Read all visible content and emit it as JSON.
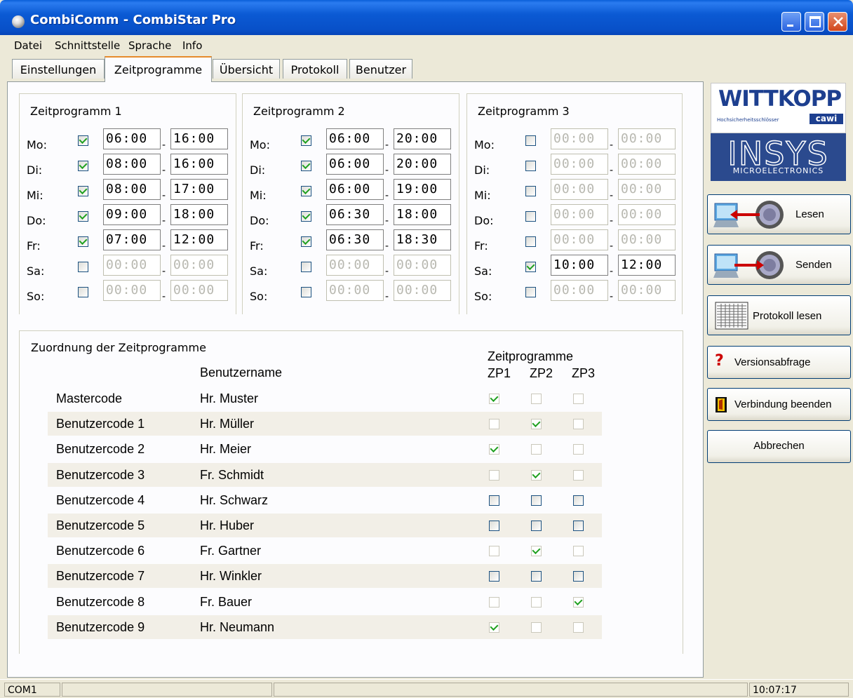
{
  "window": {
    "title": "CombiComm - CombiStar Pro"
  },
  "menu": [
    "Datei",
    "Schnittstelle",
    "Sprache",
    "Info"
  ],
  "tabs": [
    "Einstellungen",
    "Zeitprogramme",
    "Übersicht",
    "Protokoll",
    "Benutzer"
  ],
  "active_tab": "Zeitprogramme",
  "days": [
    "Mo:",
    "Di:",
    "Mi:",
    "Do:",
    "Fr:",
    "Sa:",
    "So:"
  ],
  "zeitprogramme": [
    {
      "title": "Zeitprogramm 1",
      "rows": [
        {
          "checked": true,
          "from": "06:00",
          "to": "16:00"
        },
        {
          "checked": true,
          "from": "08:00",
          "to": "16:00"
        },
        {
          "checked": true,
          "from": "08:00",
          "to": "17:00"
        },
        {
          "checked": true,
          "from": "09:00",
          "to": "18:00"
        },
        {
          "checked": true,
          "from": "07:00",
          "to": "12:00"
        },
        {
          "checked": false,
          "from": "00:00",
          "to": "00:00"
        },
        {
          "checked": false,
          "from": "00:00",
          "to": "00:00"
        }
      ]
    },
    {
      "title": "Zeitprogramm 2",
      "rows": [
        {
          "checked": true,
          "from": "06:00",
          "to": "20:00"
        },
        {
          "checked": true,
          "from": "06:00",
          "to": "20:00"
        },
        {
          "checked": true,
          "from": "06:00",
          "to": "19:00"
        },
        {
          "checked": true,
          "from": "06:30",
          "to": "18:00"
        },
        {
          "checked": true,
          "from": "06:30",
          "to": "18:30"
        },
        {
          "checked": false,
          "from": "00:00",
          "to": "00:00"
        },
        {
          "checked": false,
          "from": "00:00",
          "to": "00:00"
        }
      ]
    },
    {
      "title": "Zeitprogramm 3",
      "rows": [
        {
          "checked": false,
          "from": "00:00",
          "to": "00:00"
        },
        {
          "checked": false,
          "from": "00:00",
          "to": "00:00"
        },
        {
          "checked": false,
          "from": "00:00",
          "to": "00:00"
        },
        {
          "checked": false,
          "from": "00:00",
          "to": "00:00"
        },
        {
          "checked": false,
          "from": "00:00",
          "to": "00:00"
        },
        {
          "checked": true,
          "from": "10:00",
          "to": "12:00"
        },
        {
          "checked": false,
          "from": "00:00",
          "to": "00:00"
        }
      ]
    }
  ],
  "assignment": {
    "title": "Zuordnung der Zeitprogramme",
    "name_header": "Benutzername",
    "zp_header": "Zeitprogramme",
    "zp_cols": [
      "ZP1",
      "ZP2",
      "ZP3"
    ],
    "rows": [
      {
        "code": "Mastercode",
        "name": "Hr. Muster",
        "zp": [
          true,
          false,
          false
        ],
        "enabled": false
      },
      {
        "code": "Benutzercode 1",
        "name": "Hr. Müller",
        "zp": [
          false,
          true,
          false
        ],
        "enabled": false
      },
      {
        "code": "Benutzercode 2",
        "name": "Hr. Meier",
        "zp": [
          true,
          false,
          false
        ],
        "enabled": false
      },
      {
        "code": "Benutzercode 3",
        "name": "Fr. Schmidt",
        "zp": [
          false,
          true,
          false
        ],
        "enabled": false
      },
      {
        "code": "Benutzercode 4",
        "name": "Hr. Schwarz",
        "zp": [
          false,
          false,
          false
        ],
        "enabled": true
      },
      {
        "code": "Benutzercode 5",
        "name": "Hr. Huber",
        "zp": [
          false,
          false,
          false
        ],
        "enabled": true
      },
      {
        "code": "Benutzercode 6",
        "name": "Fr. Gartner",
        "zp": [
          false,
          true,
          false
        ],
        "enabled": false
      },
      {
        "code": "Benutzercode 7",
        "name": "Hr. Winkler",
        "zp": [
          false,
          false,
          false
        ],
        "enabled": true
      },
      {
        "code": "Benutzercode 8",
        "name": "Fr. Bauer",
        "zp": [
          false,
          false,
          true
        ],
        "enabled": false
      },
      {
        "code": "Benutzercode 9",
        "name": "Hr. Neumann",
        "zp": [
          true,
          false,
          false
        ],
        "enabled": false
      }
    ]
  },
  "logos": {
    "wittkopp": "WITTKOPP",
    "wittkopp_sub": "Hochsicherheitsschlösser",
    "cawi": "cawi",
    "insys": "INSYS",
    "insys_sub": "MICROELECTRONICS"
  },
  "buttons": {
    "lesen": "Lesen",
    "senden": "Senden",
    "protokoll": "Protokoll lesen",
    "version": "Versionsabfrage",
    "beenden": "Verbindung beenden",
    "abbrechen": "Abbrechen"
  },
  "status": {
    "port": "COM1",
    "time": "10:07:17"
  },
  "colors": {
    "titlebar": "#0b5ad4",
    "tab_highlight": "#e68b2c",
    "check": "#21a121",
    "wittkopp_blue": "#1d3f8f",
    "insys_blue": "#2b4a8e"
  }
}
